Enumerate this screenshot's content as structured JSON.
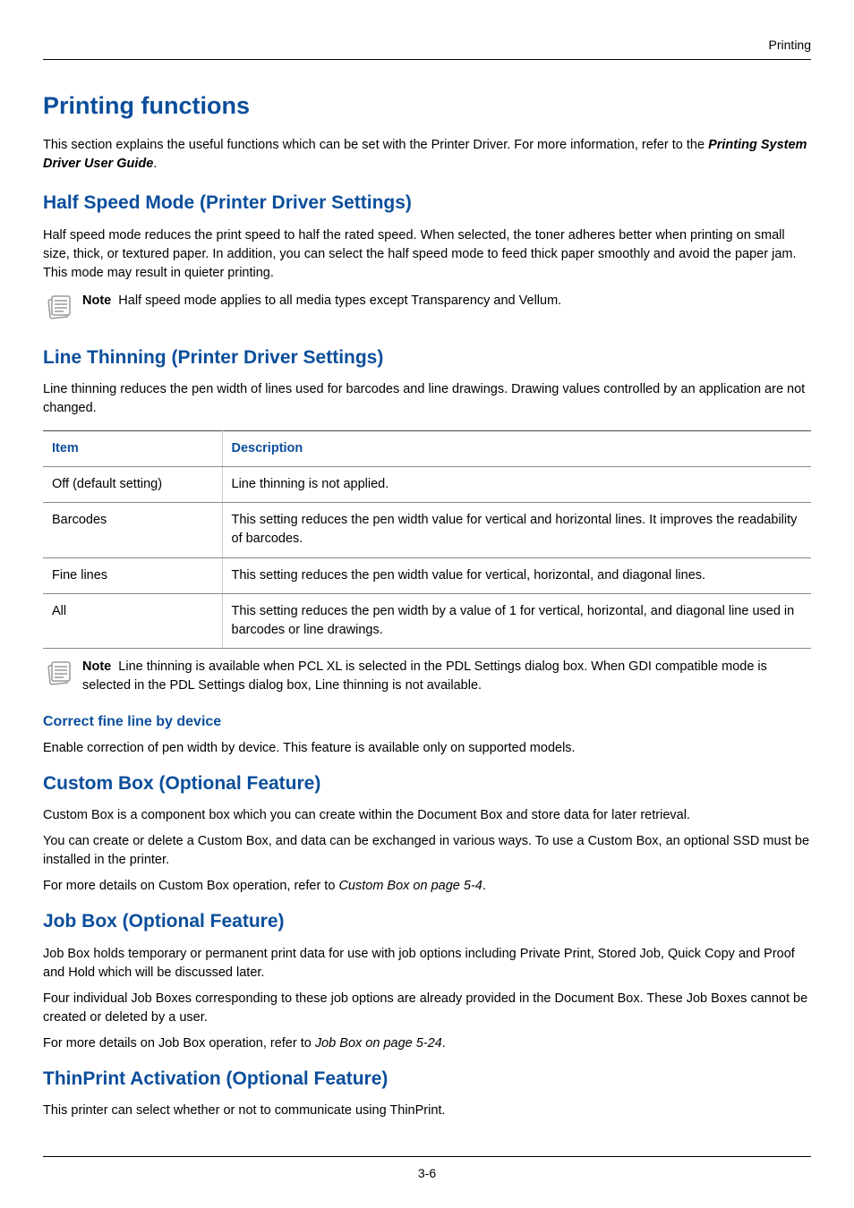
{
  "header": {
    "section": "Printing"
  },
  "page": {
    "title": "Printing functions",
    "intro_pre": "This section explains the useful functions which can be set with the Printer Driver. For more information, refer to the ",
    "intro_strong": "Printing System Driver User Guide",
    "intro_post": "."
  },
  "half_speed": {
    "heading": "Half Speed Mode (Printer Driver Settings)",
    "body": "Half speed mode reduces the print speed to half the rated speed. When selected, the toner adheres better when printing on small size, thick, or textured paper. In addition, you can select the half speed mode to feed thick paper smoothly and avoid the paper jam. This mode may result in quieter printing.",
    "note_label": "Note",
    "note_text": "Half speed mode applies to all media types except Transparency and Vellum."
  },
  "line_thinning": {
    "heading": "Line Thinning (Printer Driver Settings)",
    "body": "Line thinning reduces the pen width of lines used for barcodes and line drawings. Drawing values controlled by an application are not changed.",
    "table": {
      "headers": [
        "Item",
        "Description"
      ],
      "rows": [
        {
          "item": "Off (default setting)",
          "desc": "Line thinning is not applied."
        },
        {
          "item": "Barcodes",
          "desc": "This setting reduces the pen width value for vertical and horizontal lines. It improves the readability of barcodes."
        },
        {
          "item": "Fine lines",
          "desc": "This setting reduces the pen width value for vertical, horizontal, and diagonal lines."
        },
        {
          "item": "All",
          "desc": "This setting reduces the pen width by a value of 1 for vertical, horizontal, and diagonal line used in barcodes or line drawings."
        }
      ]
    },
    "note_label": "Note",
    "note_text": "Line thinning is available when PCL XL is selected in the PDL Settings dialog box. When GDI compatible mode is selected in the PDL Settings dialog box, Line thinning is not available."
  },
  "correct_fine_line": {
    "heading": "Correct fine line by device",
    "body": "Enable correction of pen width by device. This feature is available only on supported models."
  },
  "custom_box": {
    "heading": "Custom Box (Optional Feature)",
    "p1": "Custom Box is a component box which you can create within the Document Box and store data for later retrieval.",
    "p2": "You can create or delete a Custom Box, and data can be exchanged in various ways. To use a Custom Box, an optional SSD must be installed in the printer.",
    "p3_pre": "For more details on Custom Box operation, refer to ",
    "p3_ref": "Custom Box on page 5-4",
    "p3_post": "."
  },
  "job_box": {
    "heading": "Job Box (Optional Feature)",
    "p1": "Job Box holds temporary or permanent print data for use with job options including Private Print, Stored Job, Quick Copy and Proof and Hold which will be discussed later.",
    "p2": "Four individual Job Boxes corresponding to these job options are already provided in the Document Box. These Job Boxes cannot be created or deleted by a user.",
    "p3_pre": "For more details on Job Box operation, refer to ",
    "p3_ref": "Job Box on page 5-24",
    "p3_post": "."
  },
  "thinprint": {
    "heading": "ThinPrint Activation (Optional Feature)",
    "body": "This printer can select whether or not to communicate using ThinPrint."
  },
  "footer": {
    "page_no": "3-6"
  }
}
